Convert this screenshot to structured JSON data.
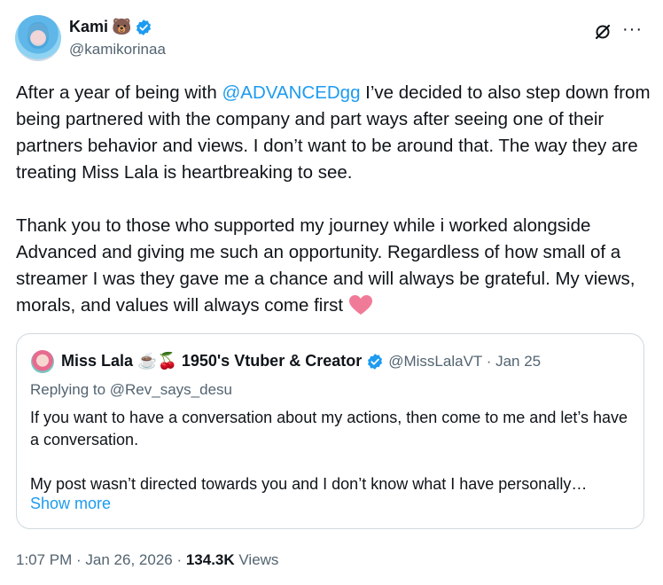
{
  "author": {
    "name": "Kami",
    "name_emoji": "🐻",
    "handle": "@kamikorinaa"
  },
  "icons": {
    "verified": "verified-badge-icon",
    "grok": "grok-icon",
    "more": "more-options-icon",
    "heart": "pink-heart-icon"
  },
  "colors": {
    "accent": "#1d9bf0",
    "secondary_text": "#536471",
    "heart": "#f07b98"
  },
  "post": {
    "p1_before": "After a year of being with ",
    "mention": "@ADVANCEDgg",
    "p1_after": " I’ve decided to also step down from being partnered with the company and part ways after seeing one of their partners behavior and views. I don’t want to be around that. The way they are treating Miss Lala is heartbreaking to see.\n\nThank you to those who supported my journey while i worked alongside Advanced and giving me such an opportunity. Regardless of how small of a streamer I was they gave me a chance and will always be grateful. My views, morals, and values will always come first "
  },
  "quote": {
    "name": "Miss Lala ☕🍒 1950's Vtuber & Creator",
    "handle_date": "@MissLalaVT · Jan 25",
    "replying_to": "Replying to @Rev_says_desu",
    "text": "If you want to have a conversation about my actions, then come to me and let’s have a conversation.\n\nMy post wasn’t directed towards you and I don’t know what I have personally…",
    "show_more": "Show more"
  },
  "meta": {
    "time_date": "1:07 PM · Jan 26, 2026 · ",
    "views_count": "134.3K",
    "views_label": " Views"
  }
}
